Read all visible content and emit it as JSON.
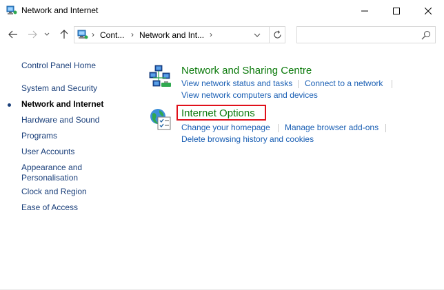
{
  "window": {
    "title": "Network and Internet",
    "minimize_glyph": "—",
    "close_glyph": "✕"
  },
  "address_bar": {
    "crumbs": [
      "Cont...",
      "Network and Int..."
    ],
    "separator": "›"
  },
  "search": {
    "placeholder": "",
    "value": ""
  },
  "sidebar": {
    "items": [
      {
        "label": "Control Panel Home",
        "active": false
      },
      {
        "label": "System and Security",
        "active": false
      },
      {
        "label": "Network and Internet",
        "active": true
      },
      {
        "label": "Hardware and Sound",
        "active": false
      },
      {
        "label": "Programs",
        "active": false
      },
      {
        "label": "User Accounts",
        "active": false
      },
      {
        "label": "Appearance and",
        "active": false
      },
      {
        "label": "Personalisation",
        "active": false
      },
      {
        "label": "Clock and Region",
        "active": false
      },
      {
        "label": "Ease of Access",
        "active": false
      }
    ]
  },
  "main": {
    "categories": [
      {
        "title": "Network and Sharing Centre",
        "icon": "network-sharing-icon",
        "links": [
          "View network status and tasks",
          "Connect to a network",
          "View network computers and devices"
        ]
      },
      {
        "title": "Internet Options",
        "icon": "internet-options-icon",
        "links": [
          "Change your homepage",
          "Manage browser add-ons",
          "Delete browsing history and cookies"
        ],
        "highlighted": true
      }
    ]
  },
  "colors": {
    "category_title": "#0b7a0b",
    "link": "#1a5fb4",
    "sidebar_link": "#1a3f7a",
    "highlight_box": "#e0101a"
  }
}
